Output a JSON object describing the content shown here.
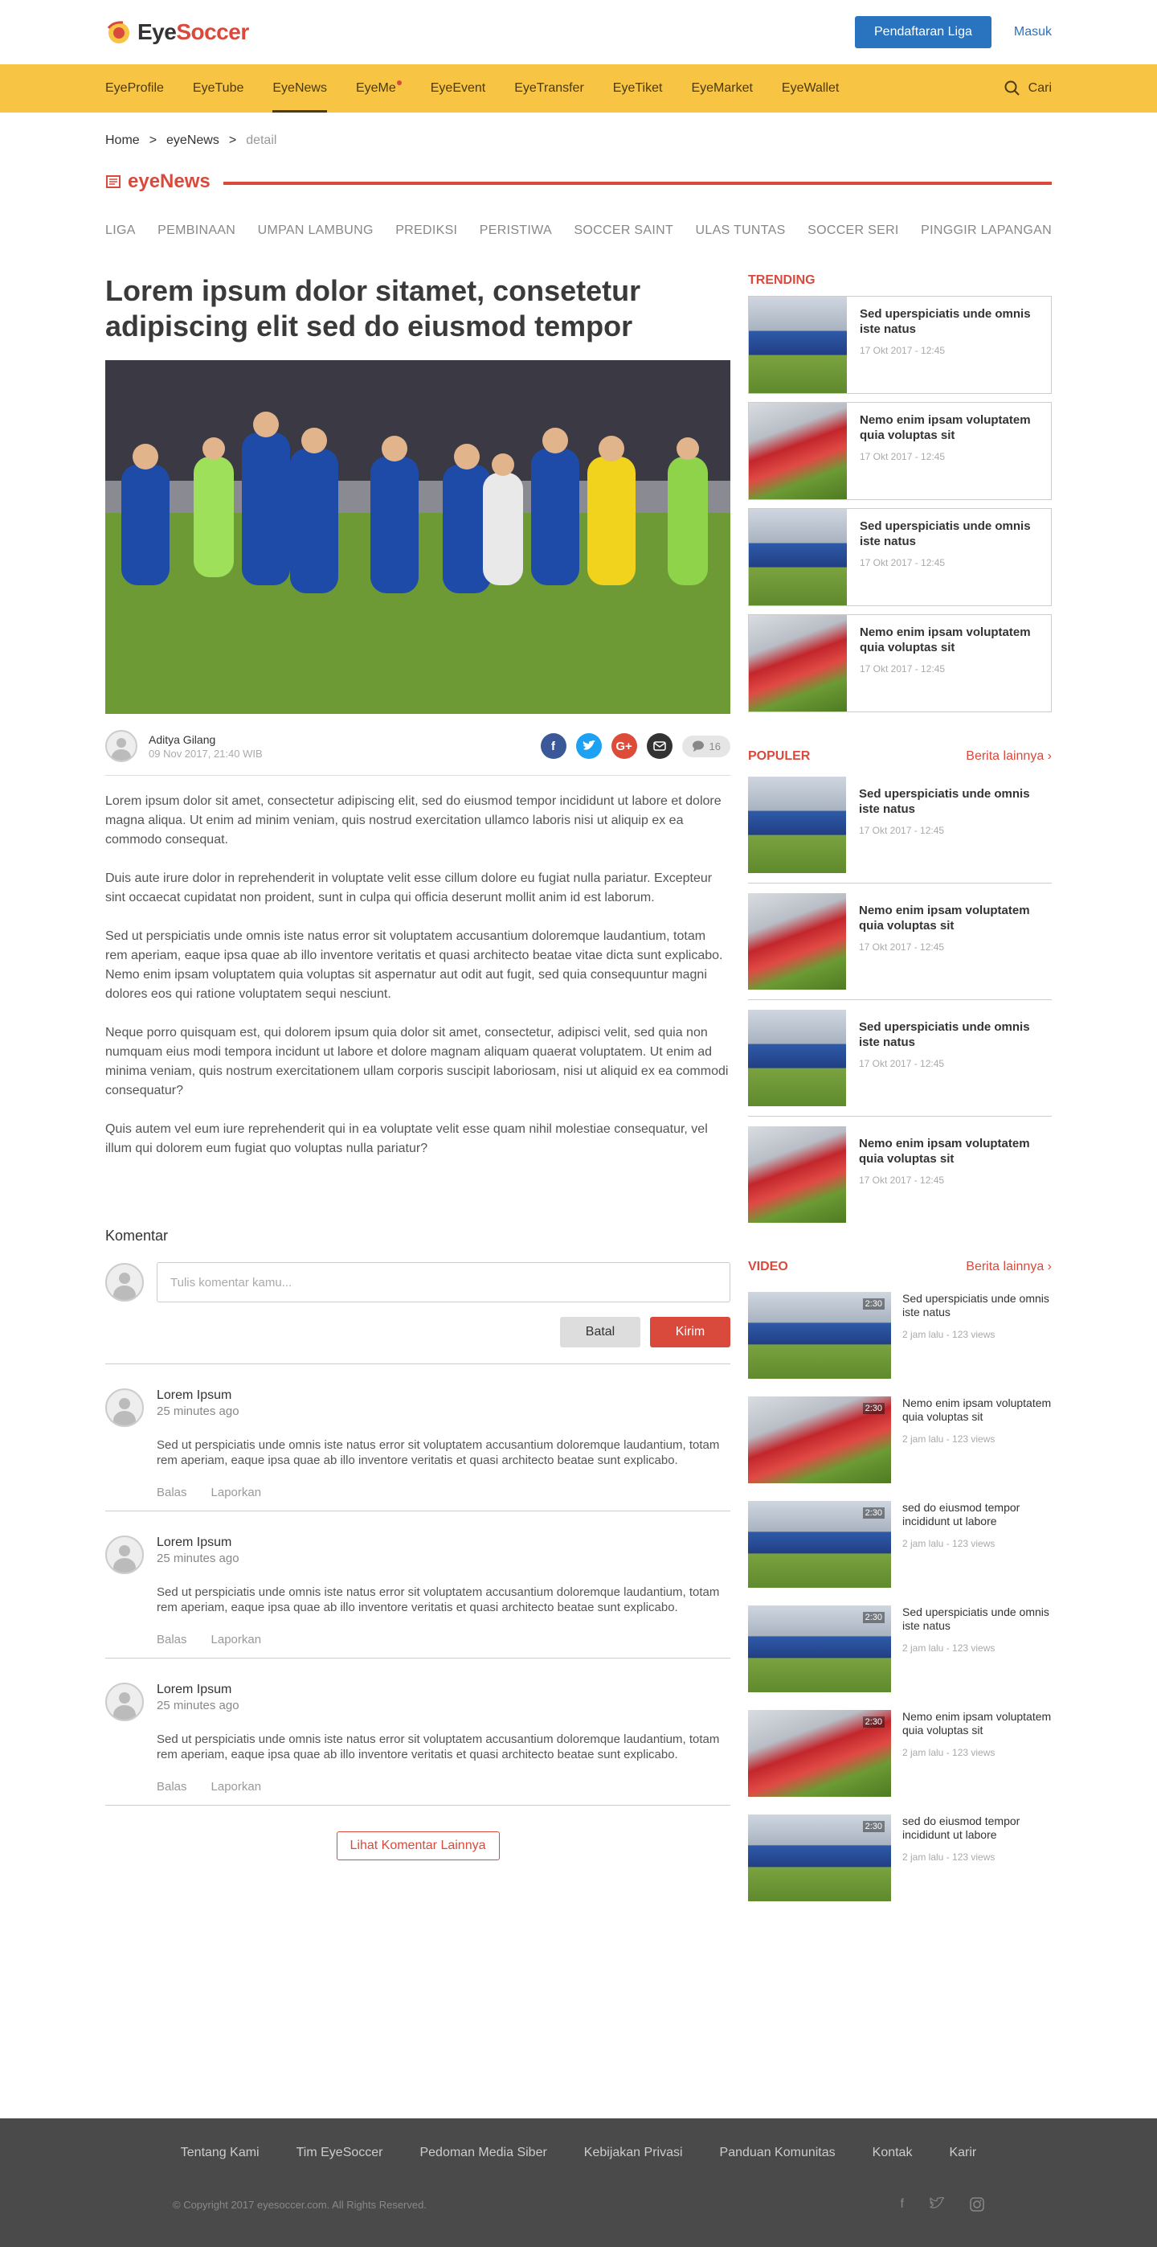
{
  "brand": {
    "eye": "Eye",
    "soccer": "Soccer"
  },
  "header": {
    "register_label": "Pendaftaran Liga",
    "login_label": "Masuk"
  },
  "nav": {
    "items": [
      "EyeProfile",
      "EyeTube",
      "EyeNews",
      "EyeMe",
      "EyeEvent",
      "EyeTransfer",
      "EyeTiket",
      "EyeMarket",
      "EyeWallet"
    ],
    "active": "EyeNews",
    "search_label": "Cari"
  },
  "breadcrumb": {
    "home": "Home",
    "sep": ">",
    "section": "eyeNews",
    "current": "detail"
  },
  "section_title": "eyeNews",
  "categories": [
    "LIGA",
    "PEMBINAAN",
    "UMPAN LAMBUNG",
    "PREDIKSI",
    "PERISTIWA",
    "SOCCER SAINT",
    "ULAS TUNTAS",
    "SOCCER SERI",
    "PINGGIR LAPANGAN"
  ],
  "article": {
    "title": "Lorem ipsum dolor sitamet, consetetur adipiscing elit sed do eiusmod tempor",
    "author": "Aditya Gilang",
    "date": "09 Nov 2017, 21:40 WIB",
    "comment_count": "16",
    "paragraphs": [
      "Lorem ipsum dolor sit amet, consectetur adipiscing elit, sed do eiusmod tempor incididunt ut labore et dolore magna aliqua. Ut enim ad minim veniam, quis nostrud exercitation ullamco laboris nisi ut aliquip ex ea commodo consequat.",
      "Duis aute irure dolor in reprehenderit in voluptate velit esse cillum dolore eu fugiat nulla pariatur. Excepteur sint occaecat cupidatat non proident, sunt in culpa qui officia deserunt mollit anim id est laborum.",
      "Sed ut perspiciatis unde omnis iste natus error sit voluptatem accusantium doloremque laudantium, totam rem aperiam, eaque ipsa quae ab illo inventore veritatis et quasi architecto beatae vitae dicta sunt explicabo. Nemo enim ipsam voluptatem quia voluptas sit aspernatur aut odit aut fugit, sed quia consequuntur magni dolores eos qui ratione voluptatem sequi nesciunt.",
      "Neque porro quisquam est, qui dolorem ipsum quia dolor sit amet, consectetur, adipisci velit, sed quia non numquam eius modi tempora incidunt ut labore et dolore magnam aliquam quaerat voluptatem. Ut enim ad minima veniam, quis nostrum exercitationem ullam corporis suscipit laboriosam, nisi ut aliquid ex ea commodi consequatur?",
      "Quis autem vel eum iure reprehenderit qui in ea voluptate velit esse quam nihil molestiae consequatur, vel illum qui dolorem eum fugiat quo voluptas nulla pariatur?"
    ]
  },
  "comments": {
    "heading": "Komentar",
    "placeholder": "Tulis komentar kamu...",
    "cancel_label": "Batal",
    "send_label": "Kirim",
    "reply_label": "Balas",
    "report_label": "Laporkan",
    "more_label": "Lihat Komentar Lainnya",
    "items": [
      {
        "name": "Lorem Ipsum",
        "time": "25 minutes ago",
        "text": "Sed ut perspiciatis unde omnis iste natus error sit voluptatem accusantium doloremque laudantium, totam rem aperiam, eaque ipsa quae ab illo inventore veritatis et quasi architecto beatae sunt explicabo."
      },
      {
        "name": "Lorem Ipsum",
        "time": "25 minutes ago",
        "text": "Sed ut perspiciatis unde omnis iste natus error sit voluptatem accusantium doloremque laudantium, totam rem aperiam, eaque ipsa quae ab illo inventore veritatis et quasi architecto beatae sunt explicabo."
      },
      {
        "name": "Lorem Ipsum",
        "time": "25 minutes ago",
        "text": "Sed ut perspiciatis unde omnis iste natus error sit voluptatem accusantium doloremque laudantium, totam rem aperiam, eaque ipsa quae ab illo inventore veritatis et quasi architecto beatae sunt explicabo."
      }
    ]
  },
  "trending": {
    "heading": "TRENDING",
    "items": [
      {
        "title": "Sed uperspiciatis unde omnis iste natus",
        "date": "17 Okt 2017 - 12:45"
      },
      {
        "title": "Nemo enim ipsam voluptatem quia voluptas sit",
        "date": "17 Okt 2017 - 12:45"
      },
      {
        "title": "Sed uperspiciatis unde omnis iste natus",
        "date": "17 Okt 2017 - 12:45"
      },
      {
        "title": "Nemo enim ipsam voluptatem quia voluptas sit",
        "date": "17 Okt 2017 - 12:45"
      }
    ]
  },
  "populer": {
    "heading": "POPULER",
    "more_label": "Berita lainnya",
    "items": [
      {
        "title": "Sed uperspiciatis unde omnis iste natus",
        "date": "17 Okt 2017 - 12:45"
      },
      {
        "title": "Nemo enim ipsam voluptatem quia voluptas sit",
        "date": "17 Okt 2017 - 12:45"
      },
      {
        "title": "Sed uperspiciatis unde omnis iste natus",
        "date": "17 Okt 2017 - 12:45"
      },
      {
        "title": "Nemo enim ipsam voluptatem quia voluptas sit",
        "date": "17 Okt 2017 - 12:45"
      }
    ]
  },
  "video": {
    "heading": "VIDEO",
    "more_label": "Berita lainnya",
    "items": [
      {
        "title": "Sed uperspiciatis unde omnis iste natus",
        "meta": "2 jam lalu - 123 views",
        "duration": "2:30"
      },
      {
        "title": "Nemo enim ipsam voluptatem quia voluptas sit",
        "meta": "2 jam lalu - 123 views",
        "duration": "2:30"
      },
      {
        "title": "sed do eiusmod tempor incididunt ut labore",
        "meta": "2 jam lalu - 123 views",
        "duration": "2:30"
      },
      {
        "title": "Sed uperspiciatis unde omnis iste natus",
        "meta": "2 jam lalu - 123 views",
        "duration": "2:30"
      },
      {
        "title": "Nemo enim ipsam voluptatem quia voluptas sit",
        "meta": "2 jam lalu - 123 views",
        "duration": "2:30"
      },
      {
        "title": "sed do eiusmod tempor incididunt ut labore",
        "meta": "2 jam lalu - 123 views",
        "duration": "2:30"
      }
    ]
  },
  "footer": {
    "links": [
      "Tentang Kami",
      "Tim EyeSoccer",
      "Pedoman Media Siber",
      "Kebijakan Privasi",
      "Panduan Komunitas",
      "Kontak",
      "Karir"
    ],
    "copyright": "© Copyright 2017 eyesoccer.com. All Rights Reserved."
  },
  "colors": {
    "accent": "#d94a3d",
    "nav_bg": "#f7c444",
    "primary": "#2a73bf",
    "footer_bg": "#4a4a4a"
  }
}
